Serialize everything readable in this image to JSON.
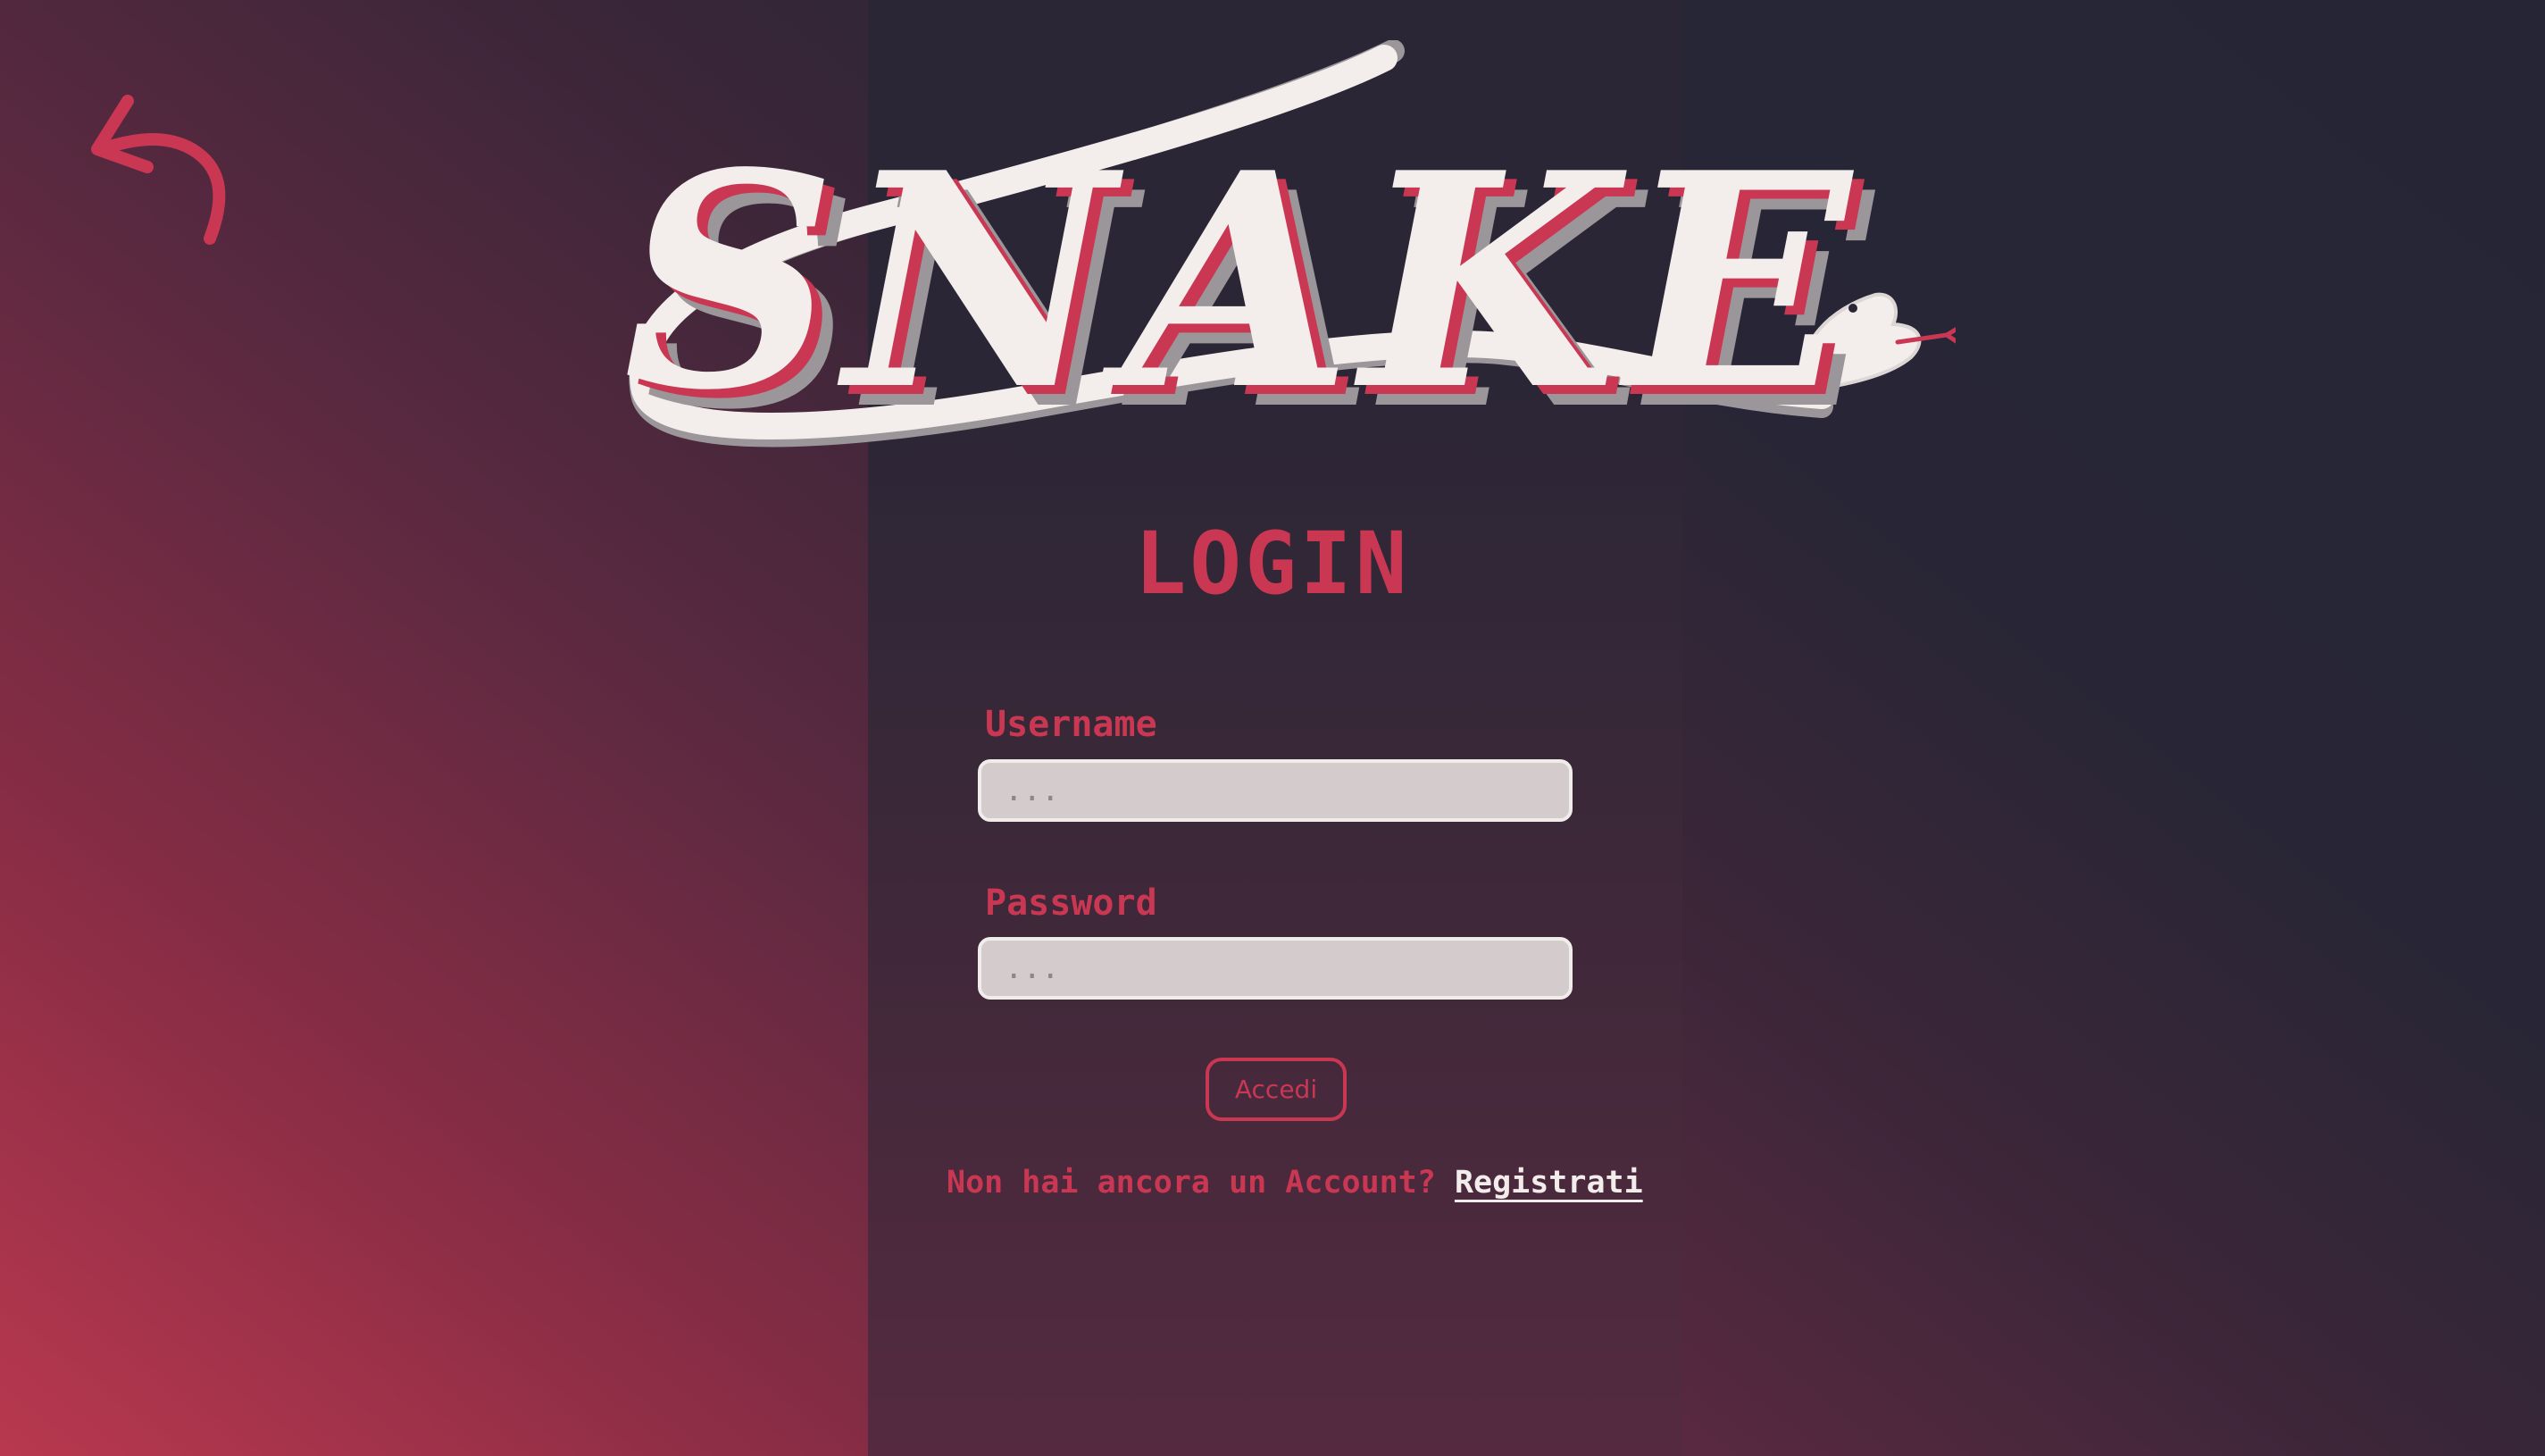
{
  "logo": {
    "text": "SNAKE"
  },
  "back_button": {
    "icon": "undo-arrow-icon"
  },
  "page": {
    "title": "LOGIN"
  },
  "form": {
    "username_label": "Username",
    "username_placeholder": "...",
    "password_label": "Password",
    "password_placeholder": "...",
    "submit_label": "Accedi"
  },
  "register": {
    "prompt": "Non hai ancora un Account?",
    "link": "Registrati"
  },
  "colors": {
    "accent": "#c93753",
    "panel": "#2a2636",
    "logo_fill": "#f3eeeb"
  }
}
